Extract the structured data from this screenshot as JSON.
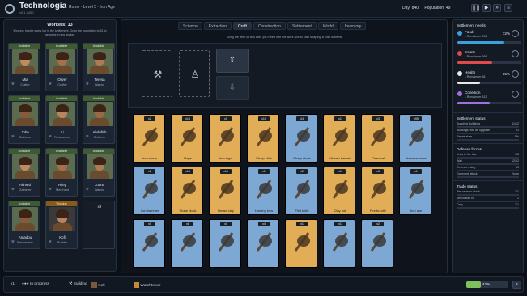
{
  "app": {
    "title": "Technologia",
    "version": "v0.1.2450",
    "location": "Rome · Level 5 · Iron Age"
  },
  "stats": {
    "day": "Day: 840",
    "population": "Population: 49"
  },
  "workers": {
    "title": "Workers: 13",
    "hint": "Workers handle every job in the settlement. Grow the population to 51 to welcome a new worker.",
    "cards": [
      {
        "status": "Available",
        "name": "Mia",
        "role": "Crafter"
      },
      {
        "status": "Available",
        "name": "Oliver",
        "role": "Crafter"
      },
      {
        "status": "Available",
        "name": "Teresa",
        "role": "Warrior"
      },
      {
        "status": "Available",
        "name": "John",
        "role": "Gatherer"
      },
      {
        "status": "Available",
        "name": "Li",
        "role": "Researcher"
      },
      {
        "status": "Available",
        "name": "Abdullah",
        "role": "Gatherer"
      },
      {
        "status": "Available",
        "name": "Ahmed",
        "role": "Gatherer"
      },
      {
        "status": "Available",
        "name": "Riley",
        "role": "Merchant"
      },
      {
        "status": "Available",
        "name": "Joana",
        "role": "Warrior"
      },
      {
        "status": "Available",
        "name": "Amadou",
        "role": "Researcher"
      },
      {
        "status": "Working",
        "name": "Kofi",
        "role": "Builder"
      },
      {
        "status": "",
        "name": "x2",
        "role": ""
      }
    ]
  },
  "tabs": [
    "Science",
    "Extraction",
    "Craft",
    "Construction",
    "Settlement",
    "World",
    "Inventory"
  ],
  "craft": {
    "hint": "Drag the item or tool card you need into the work slot to start shaping a craft scheme."
  },
  "items": [
    {
      "name": "Iron spear",
      "count": "x2",
      "color": "gold"
    },
    {
      "name": "Rope",
      "count": "x13",
      "color": "gold"
    },
    {
      "name": "Iron ingot",
      "count": "x1",
      "color": "gold"
    },
    {
      "name": "Sharp stick",
      "count": "x10",
      "color": "gold"
    },
    {
      "name": "Sharp stone",
      "count": "x18",
      "color": "blue"
    },
    {
      "name": "Woven basket",
      "count": "x1",
      "color": "gold"
    },
    {
      "name": "Charcoal",
      "count": "x3",
      "color": "gold"
    },
    {
      "name": "Hammerstone",
      "count": "x95",
      "color": "blue"
    },
    {
      "name": "Iron hammer",
      "count": "x2",
      "color": "blue"
    },
    {
      "name": "Stone block",
      "count": "x14",
      "color": "gold"
    },
    {
      "name": "Dense clay",
      "count": "x15",
      "color": "gold"
    },
    {
      "name": "Hunting bow",
      "count": "x1",
      "color": "blue"
    },
    {
      "name": "Flint knife",
      "count": "x2",
      "color": "blue"
    },
    {
      "name": "Clay pot",
      "count": "x1",
      "color": "gold"
    },
    {
      "name": "Fire bundle",
      "count": "x3",
      "color": "gold"
    },
    {
      "name": "Iron axe",
      "count": "x1",
      "color": "blue"
    },
    {
      "name": "",
      "count": "x0",
      "color": "blue"
    },
    {
      "name": "",
      "count": "x8",
      "color": "blue"
    },
    {
      "name": "",
      "count": "x1",
      "color": "blue"
    },
    {
      "name": "",
      "count": "x4",
      "color": "blue"
    },
    {
      "name": "",
      "count": "x1",
      "color": "gold"
    },
    {
      "name": "",
      "count": "x1",
      "color": "blue"
    },
    {
      "name": "",
      "count": "x2",
      "color": "blue"
    }
  ],
  "needs": {
    "title": "Settlement needs",
    "list": [
      {
        "name": "Food",
        "sub": "▸ Remainder 295",
        "pct": "72%",
        "color": "#3aa0e0"
      },
      {
        "name": "Safety",
        "sub": "▸ Remainder 689",
        "pct": "",
        "color": "#e04a4a"
      },
      {
        "name": "Health",
        "sub": "▸ Remainder 68",
        "pct": "35%",
        "color": "#e8e8e8"
      },
      {
        "name": "Cohesion",
        "sub": "▸ Remainder 512",
        "pct": "",
        "color": "#a070e0"
      }
    ]
  },
  "status": {
    "title": "Settlement status",
    "rows": [
      {
        "k": "Supplied buildings",
        "v": "11/12"
      },
      {
        "k": "Buildings with an upgrade",
        "v": "x1"
      },
      {
        "k": "Repair state",
        "v": "9%"
      }
    ]
  },
  "defense": {
    "title": "Defense forces",
    "rows": [
      {
        "k": "Units in the line",
        "v": "7/8"
      },
      {
        "k": "Wall",
        "v": "12/12"
      },
      {
        "k": "Defense rating",
        "v": "55"
      },
      {
        "k": "Expected attack",
        "v": "None"
      }
    ]
  },
  "trade": {
    "title": "Trade status",
    "rows": [
      {
        "k": "Per caravan stock",
        "v": "1/1"
      },
      {
        "k": "Merchants on",
        "v": "1"
      },
      {
        "k": "Daily",
        "v": "1/1"
      }
    ]
  },
  "bottom": {
    "count": "x1",
    "progress": "In progress",
    "building": "Building",
    "worker": "Kofi",
    "task": "Watchtower",
    "percent": "42%"
  }
}
